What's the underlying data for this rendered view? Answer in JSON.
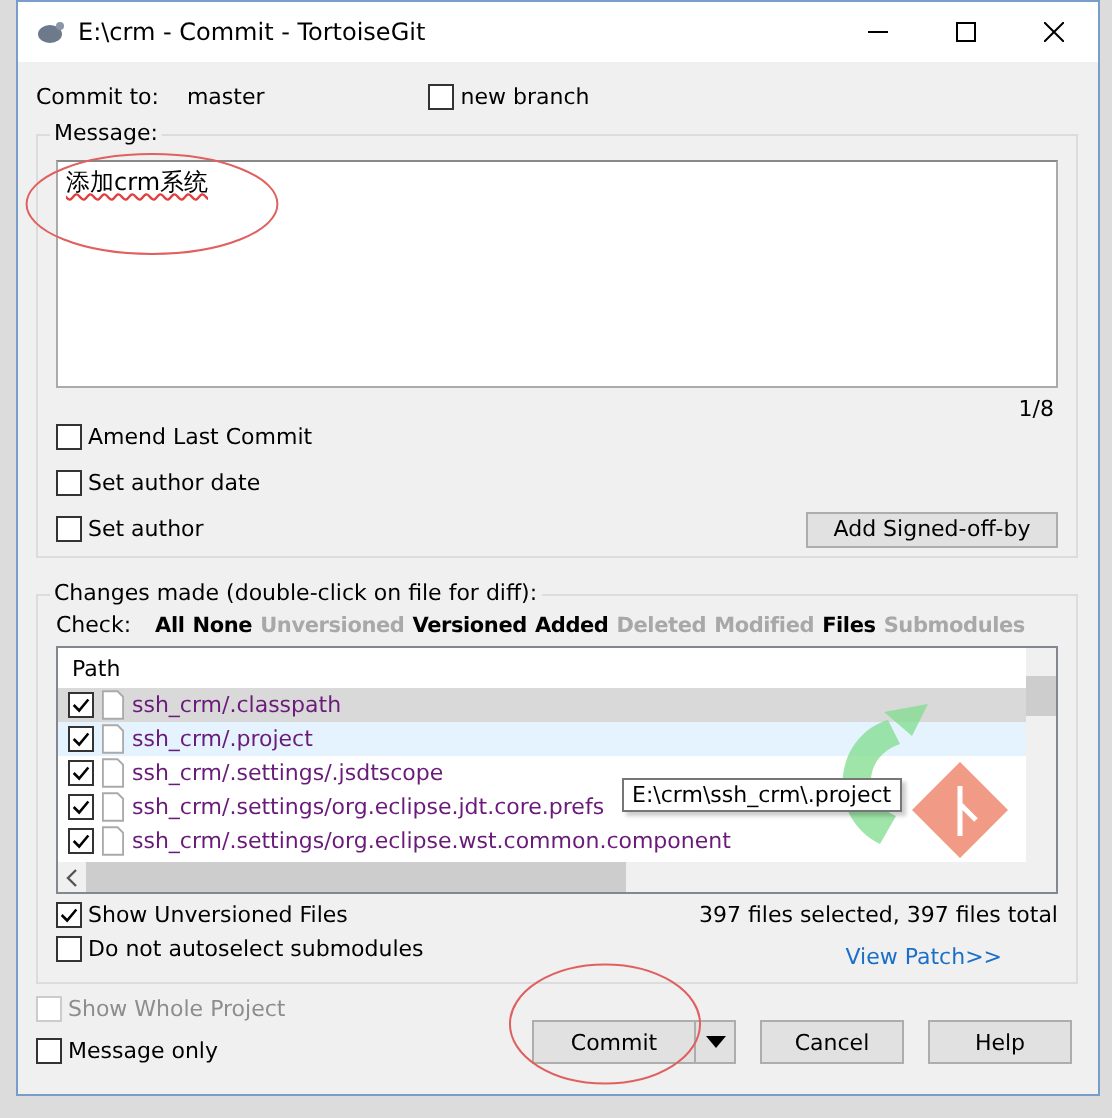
{
  "window": {
    "title": "E:\\crm - Commit - TortoiseGit"
  },
  "commit_to": {
    "label": "Commit to:",
    "branch": "master"
  },
  "new_branch": {
    "label": "new branch",
    "checked": false
  },
  "message": {
    "label": "Message:",
    "value": "添加crm系统",
    "counter": "1/8"
  },
  "message_options": [
    {
      "label": "Amend Last Commit",
      "checked": false
    },
    {
      "label": "Set author date",
      "checked": false
    },
    {
      "label": "Set author",
      "checked": false
    }
  ],
  "signoff_button": "Add Signed-off-by",
  "changes": {
    "label": "Changes made (double-click on file for diff):",
    "check_label": "Check:",
    "filters": [
      {
        "label": "All",
        "enabled": true
      },
      {
        "label": "None",
        "enabled": true
      },
      {
        "label": "Unversioned",
        "enabled": false
      },
      {
        "label": "Versioned",
        "enabled": true
      },
      {
        "label": "Added",
        "enabled": true
      },
      {
        "label": "Deleted",
        "enabled": false
      },
      {
        "label": "Modified",
        "enabled": false
      },
      {
        "label": "Files",
        "enabled": true
      },
      {
        "label": "Submodules",
        "enabled": false
      }
    ],
    "column": "Path",
    "files": [
      {
        "path": "ssh_crm/.classpath",
        "checked": true,
        "selected": true,
        "hovered": false
      },
      {
        "path": "ssh_crm/.project",
        "checked": true,
        "selected": false,
        "hovered": true
      },
      {
        "path": "ssh_crm/.settings/.jsdtscope",
        "checked": true,
        "selected": false,
        "hovered": false
      },
      {
        "path": "ssh_crm/.settings/org.eclipse.jdt.core.prefs",
        "checked": true,
        "selected": false,
        "hovered": false
      },
      {
        "path": "ssh_crm/.settings/org.eclipse.wst.common.component",
        "checked": true,
        "selected": false,
        "hovered": false
      }
    ],
    "tooltip": "E:\\crm\\ssh_crm\\.project",
    "options": [
      {
        "label": "Show Unversioned Files",
        "checked": true
      },
      {
        "label": "Do not autoselect submodules",
        "checked": false
      }
    ],
    "summary": "397 files selected, 397 files total",
    "view_patch": "View Patch>>"
  },
  "bottom_options": [
    {
      "label": "Show Whole Project",
      "checked": false,
      "disabled": true
    },
    {
      "label": "Message only",
      "checked": false,
      "disabled": false
    }
  ],
  "buttons": {
    "commit": "Commit",
    "cancel": "Cancel",
    "help": "Help"
  }
}
